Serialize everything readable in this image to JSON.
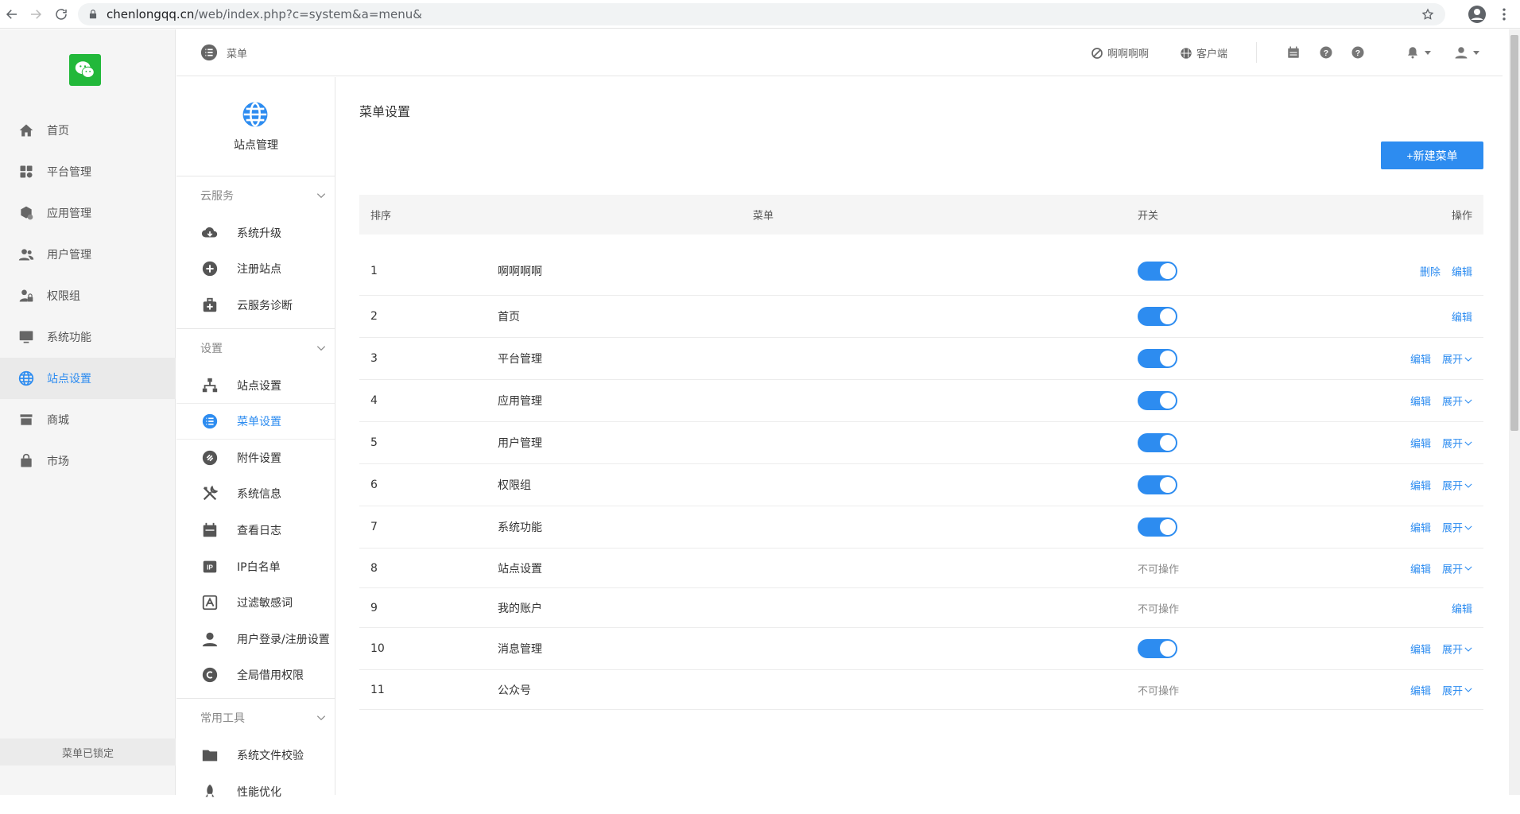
{
  "browser": {
    "url_host": "chenlongqq.cn",
    "url_path": "/web/index.php?c=system&a=menu&"
  },
  "sidebar": {
    "items": [
      {
        "label": "首页",
        "icon": "home-icon"
      },
      {
        "label": "平台管理",
        "icon": "grid-settings-icon"
      },
      {
        "label": "应用管理",
        "icon": "cube-gear-icon"
      },
      {
        "label": "用户管理",
        "icon": "users-icon"
      },
      {
        "label": "权限组",
        "icon": "user-lock-icon"
      },
      {
        "label": "系统功能",
        "icon": "monitor-icon"
      },
      {
        "label": "站点设置",
        "icon": "globe-icon",
        "active": true
      },
      {
        "label": "商城",
        "icon": "store-icon"
      },
      {
        "label": "市场",
        "icon": "bag-icon"
      }
    ],
    "lock_label": "菜单已锁定"
  },
  "topbar": {
    "crumb": "菜单",
    "link_1": "啊啊啊啊",
    "link_2": "客户端"
  },
  "sub_sidebar": {
    "title": "站点管理",
    "groups": [
      {
        "label": "云服务",
        "items": [
          "系统升级",
          "注册站点",
          "云服务诊断"
        ]
      },
      {
        "label": "设置",
        "items": [
          "站点设置",
          "菜单设置",
          "附件设置",
          "系统信息",
          "查看日志",
          "IP白名单",
          "过滤敏感词",
          "用户登录/注册设置",
          "全局借用权限"
        ]
      },
      {
        "label": "常用工具",
        "items": [
          "系统文件校验",
          "性能优化"
        ]
      }
    ]
  },
  "main": {
    "title": "菜单设置",
    "new_button": "+新建菜单",
    "headers": {
      "order": "排序",
      "menu": "菜单",
      "switch": "开关",
      "ops": "操作"
    },
    "rows": [
      {
        "order": "1",
        "name": "啊啊啊啊",
        "switch": true,
        "ops": [
          "删除",
          "编辑"
        ]
      },
      {
        "order": "2",
        "name": "首页",
        "switch": true,
        "ops": [
          "编辑"
        ]
      },
      {
        "order": "3",
        "name": "平台管理",
        "switch": true,
        "ops": [
          "编辑",
          "展开"
        ]
      },
      {
        "order": "4",
        "name": "应用管理",
        "switch": true,
        "ops": [
          "编辑",
          "展开"
        ]
      },
      {
        "order": "5",
        "name": "用户管理",
        "switch": true,
        "ops": [
          "编辑",
          "展开"
        ]
      },
      {
        "order": "6",
        "name": "权限组",
        "switch": true,
        "ops": [
          "编辑",
          "展开"
        ]
      },
      {
        "order": "7",
        "name": "系统功能",
        "switch": true,
        "ops": [
          "编辑",
          "展开"
        ]
      },
      {
        "order": "8",
        "name": "站点设置",
        "switch": false,
        "switch_text": "不可操作",
        "ops": [
          "编辑",
          "展开"
        ]
      },
      {
        "order": "9",
        "name": "我的账户",
        "switch": false,
        "switch_text": "不可操作",
        "ops": [
          "编辑"
        ]
      },
      {
        "order": "10",
        "name": "消息管理",
        "switch": true,
        "ops": [
          "编辑",
          "展开"
        ]
      },
      {
        "order": "11",
        "name": "公众号",
        "switch": false,
        "switch_text": "不可操作",
        "ops": [
          "编辑",
          "展开"
        ]
      }
    ]
  },
  "colors": {
    "accent": "#2d8cf0",
    "logo_green": "#22b83a"
  }
}
